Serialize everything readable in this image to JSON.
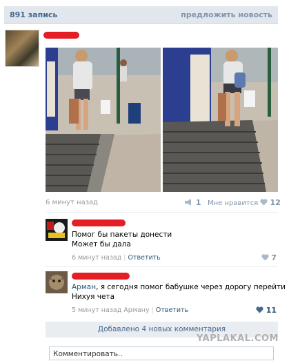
{
  "header": {
    "count": "891 запись",
    "suggest": "предложить новость"
  },
  "post": {
    "time": "6 минут назад",
    "reposts": "1",
    "like_label": "Мне нравится",
    "likes": "12"
  },
  "comments": [
    {
      "lines": [
        "Помог бы пакеты донести",
        "Может бы дала"
      ],
      "time": "6 минут назад",
      "reply": "Ответить",
      "likes": "7"
    },
    {
      "to": "Арман",
      "text": ", я сегодня помог бабушке через дорогу перейти",
      "line2": "Нихуя чета",
      "time": "5 минут назад Арману",
      "reply": "Ответить",
      "likes": "11"
    }
  ],
  "added_label": "Добавлено 4 новых комментария",
  "watermark": "YAPLAKAL.COM",
  "comment_placeholder": "Комментировать..",
  "colors": {
    "accent": "#45688e",
    "link": "#2b587a",
    "redaction": "#e31e24"
  },
  "icons": [
    "megaphone-icon",
    "heart-icon"
  ]
}
